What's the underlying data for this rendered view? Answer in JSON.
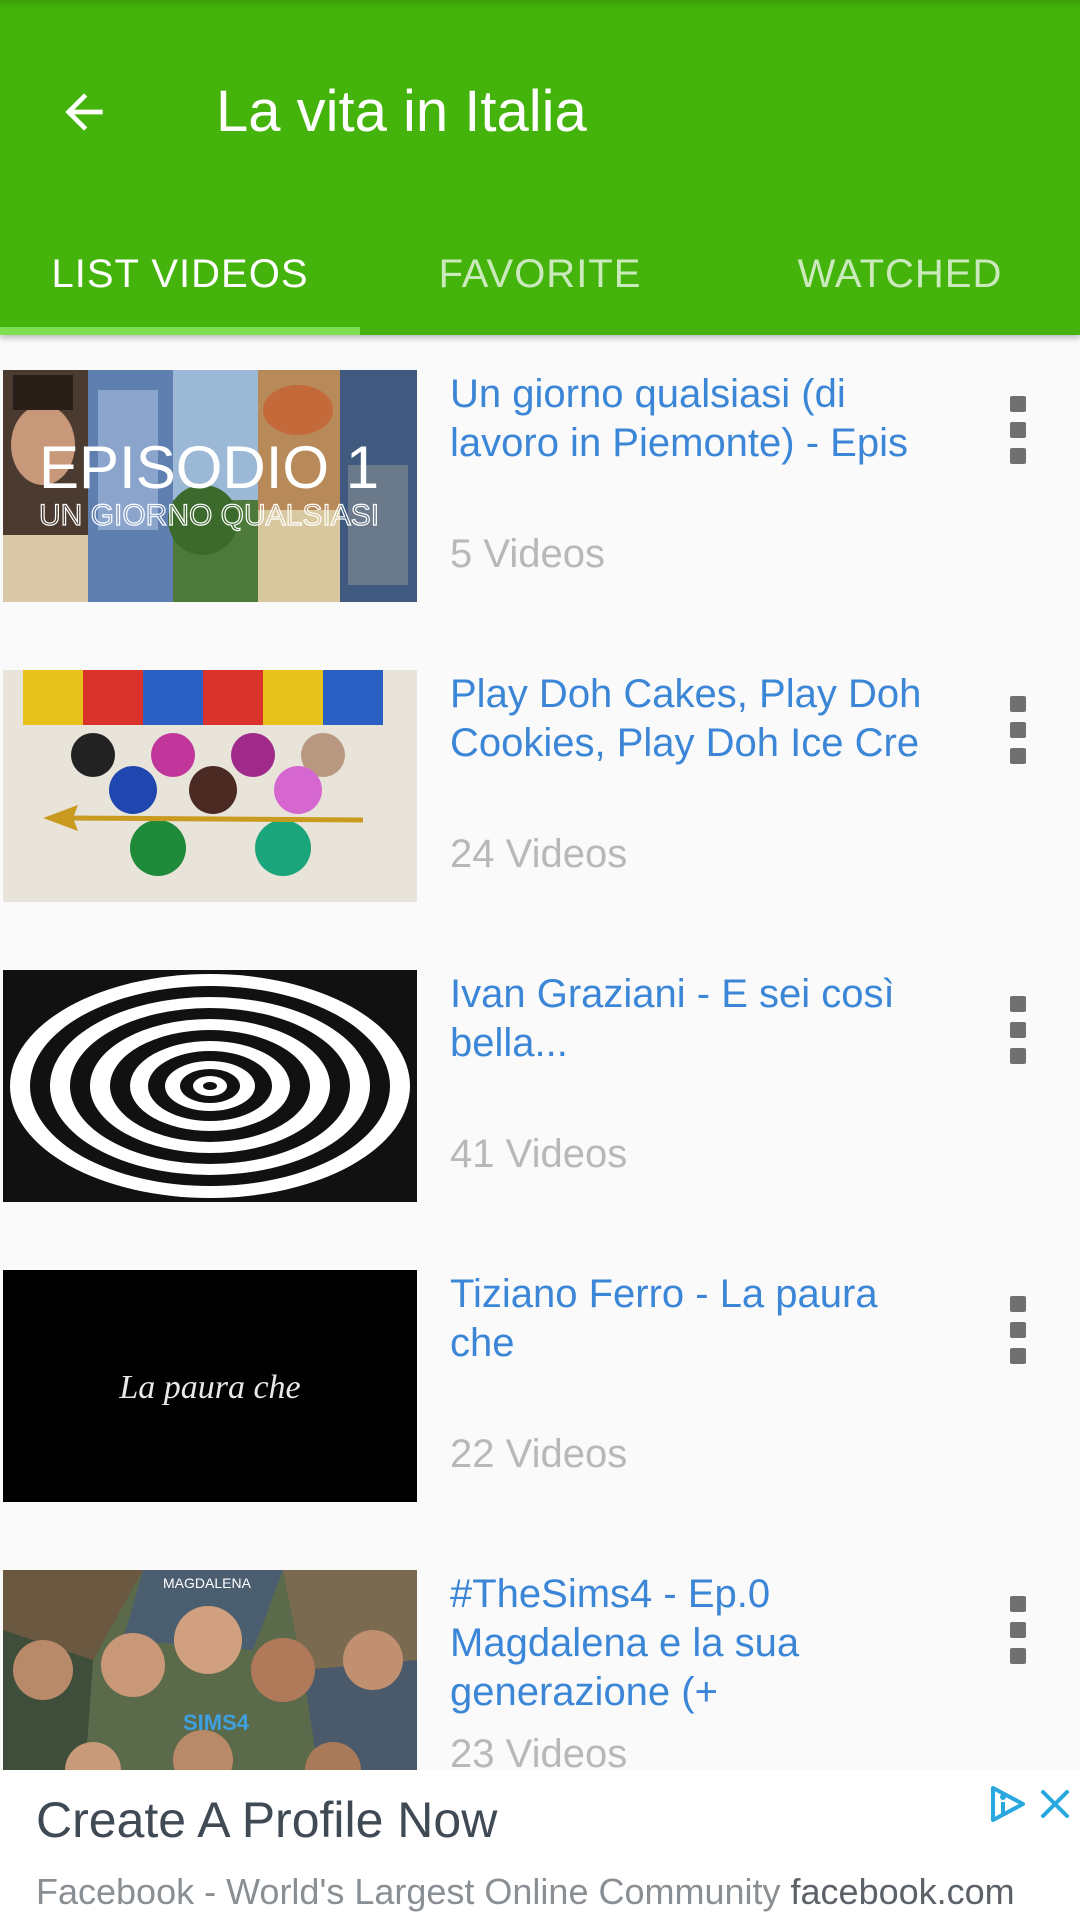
{
  "header": {
    "title": "La vita in Italia",
    "back_icon": "arrow-left-icon"
  },
  "tabs": [
    {
      "label": "LIST VIDEOS",
      "active": true
    },
    {
      "label": "FAVORITE",
      "active": false
    },
    {
      "label": "WATCHED",
      "active": false
    }
  ],
  "colors": {
    "app_bar": "#44b40c",
    "tab_indicator": "#7ee051",
    "item_title": "#3b86d6",
    "item_count": "#b8b8b8"
  },
  "playlists": [
    {
      "title": "Un giorno qualsiasi (di lavoro in Piemonte) - Epis",
      "count": "5 Videos",
      "thumbnail_text": [
        "EPISODIO 1",
        "UN GIORNO QUALSIASI"
      ]
    },
    {
      "title": "Play Doh Cakes, Play Doh Cookies, Play Doh Ice Cre",
      "count": "24 Videos",
      "thumbnail_text": []
    },
    {
      "title": "Ivan Graziani - E sei così bella...",
      "count": "41 Videos",
      "thumbnail_text": []
    },
    {
      "title": "Tiziano Ferro - La paura che",
      "count": "22 Videos",
      "thumbnail_text": [
        "La paura che"
      ]
    },
    {
      "title": "#TheSims4 - Ep.0 Magdalena e la sua generazione (+",
      "count": "23 Videos",
      "thumbnail_text": [
        "MAGDALENA",
        "SIMS4"
      ]
    }
  ],
  "ad": {
    "headline": "Create A Profile Now",
    "source": "Facebook - World's Largest Online Community",
    "domain": "facebook.com",
    "choices_icon": "ad-choices-icon",
    "close_icon": "close-icon"
  }
}
